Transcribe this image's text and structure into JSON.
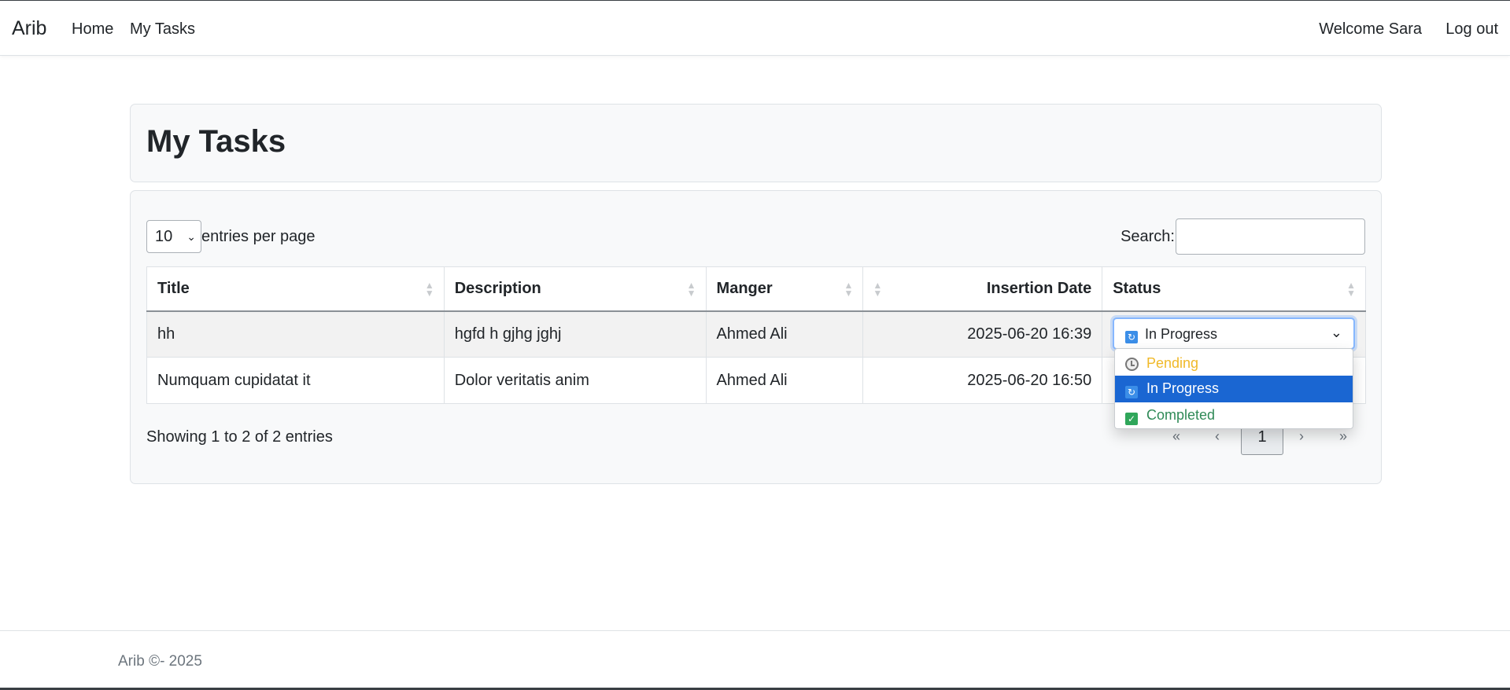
{
  "navbar": {
    "brand": "Arib",
    "links": [
      "Home",
      "My Tasks"
    ],
    "welcome": "Welcome Sara",
    "logout": "Log out"
  },
  "page": {
    "title": "My Tasks"
  },
  "table_controls": {
    "entries_value": "10",
    "entries_label": "entries per page",
    "search_label": "Search:",
    "search_value": ""
  },
  "table": {
    "columns": [
      "Title",
      "Description",
      "Manger",
      "Insertion Date",
      "Status"
    ],
    "rows": [
      {
        "title": "hh",
        "description": "hgfd h gjhg jghj",
        "manager": "Ahmed Ali",
        "date": "2025-06-20 16:39",
        "status": "In Progress"
      },
      {
        "title": "Numquam cupidatat it",
        "description": "Dolor veritatis anim",
        "manager": "Ahmed Ali",
        "date": "2025-06-20 16:50",
        "status": ""
      }
    ]
  },
  "status_dropdown": {
    "selected": "In Progress",
    "options": [
      {
        "label": "Pending",
        "icon": "clock-icon",
        "color": "#f0b929"
      },
      {
        "label": "In Progress",
        "icon": "refresh-icon",
        "color": "#ffffff"
      },
      {
        "label": "Completed",
        "icon": "check-icon",
        "color": "#2f8a57"
      }
    ]
  },
  "pagination": {
    "info": "Showing 1 to 2 of 2 entries",
    "first": "«",
    "prev": "‹",
    "current": "1",
    "next": "›",
    "last": "»"
  },
  "footer": {
    "text": "Arib ©- 2025"
  },
  "colors": {
    "accent": "#1a66d2",
    "focus_border": "#86b7fe"
  }
}
